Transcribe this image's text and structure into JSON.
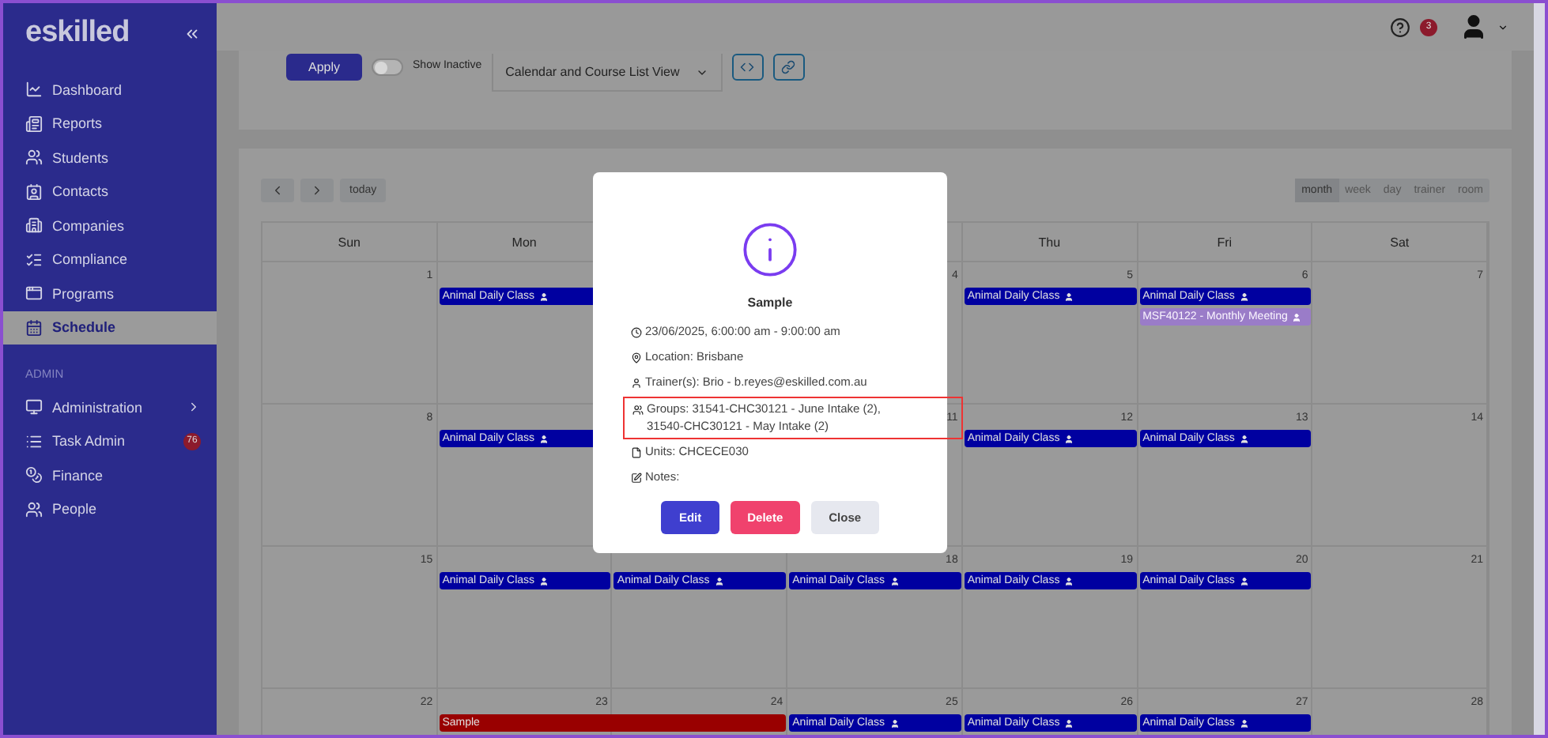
{
  "sidebar": {
    "logo": "eskilled",
    "items": [
      {
        "label": "Dashboard",
        "selected": false
      },
      {
        "label": "Reports",
        "selected": false
      },
      {
        "label": "Students",
        "selected": false
      },
      {
        "label": "Contacts",
        "selected": false
      },
      {
        "label": "Companies",
        "selected": false
      },
      {
        "label": "Compliance",
        "selected": false
      },
      {
        "label": "Programs",
        "selected": false
      },
      {
        "label": "Schedule",
        "selected": true
      }
    ],
    "section": "ADMIN",
    "admin_items": [
      {
        "label": "Administration",
        "selected": false,
        "submenu": true
      },
      {
        "label": "Task Admin",
        "selected": false,
        "submenu": false,
        "badge": "76"
      },
      {
        "label": "Finance",
        "selected": false,
        "submenu": false
      },
      {
        "label": "People",
        "selected": false,
        "submenu": false
      }
    ]
  },
  "header": {
    "help_badge": "3"
  },
  "filters": {
    "apply": "Apply",
    "show_inactive": {
      "label": "Show Inactive",
      "on": false
    },
    "view_select": "Calendar and Course List View"
  },
  "calendar": {
    "today": "today",
    "views": [
      {
        "label": "month",
        "selected": true
      },
      {
        "label": "week",
        "selected": false
      },
      {
        "label": "day",
        "selected": false
      },
      {
        "label": "trainer",
        "selected": false
      },
      {
        "label": "room",
        "selected": false
      }
    ],
    "weekdays_left": [
      "Sun",
      "Mon"
    ],
    "weekdays_right": [
      "Thu",
      "Fri",
      "Sat"
    ],
    "weeks": [
      {
        "days_left": [
          {
            "day": "1"
          },
          {
            "events": [
              {
                "title": "Animal Daily Class",
                "color": "#0000a0",
                "kind": "one-day",
                "has_trainer": true,
                "muted": false
              }
            ]
          }
        ],
        "days_right": [
          {
            "day": "4"
          },
          {
            "day": "5",
            "events": [
              {
                "title": "Animal Daily Class",
                "color": "#0000a0",
                "kind": "one-day",
                "has_trainer": true,
                "muted": false
              }
            ]
          },
          {
            "day": "6",
            "events": [
              {
                "title": "Animal Daily Class",
                "color": "#0000a0",
                "kind": "one-day",
                "has_trainer": true,
                "muted": false
              },
              {
                "title": "MSF40122 - Monthly Meeting",
                "color": "#9a7cc8",
                "kind": "one-day",
                "has_trainer": true,
                "muted": true
              }
            ]
          },
          {
            "day": "7"
          }
        ]
      },
      {
        "days_left": [
          {
            "day": "8"
          },
          {
            "events": [
              {
                "title": "Animal Daily Class",
                "color": "#0000a0",
                "kind": "one-day",
                "has_trainer": true,
                "muted": false
              }
            ]
          }
        ],
        "days_right": [
          {
            "day": "11"
          },
          {
            "day": "12",
            "events": [
              {
                "title": "Animal Daily Class",
                "color": "#0000a0",
                "kind": "one-day",
                "has_trainer": true,
                "muted": false
              }
            ]
          },
          {
            "day": "13",
            "events": [
              {
                "title": "Animal Daily Class",
                "color": "#0000a0",
                "kind": "one-day",
                "has_trainer": true,
                "muted": false
              }
            ]
          },
          {
            "day": "14"
          }
        ]
      },
      {
        "days": [
          {
            "day": "15"
          },
          {
            "events": [
              {
                "title": "Animal Daily Class",
                "color": "#0000a0",
                "kind": "one-day",
                "has_trainer": true,
                "muted": false
              }
            ]
          },
          {
            "events": [
              {
                "title": "Animal Daily Class",
                "color": "#0000a0",
                "kind": "one-day",
                "has_trainer": true,
                "muted": false
              }
            ]
          },
          {
            "day": "18",
            "events": [
              {
                "title": "Animal Daily Class",
                "color": "#0000a0",
                "kind": "one-day",
                "has_trainer": true,
                "muted": false
              }
            ]
          },
          {
            "day": "19",
            "events": [
              {
                "title": "Animal Daily Class",
                "color": "#0000a0",
                "kind": "one-day",
                "has_trainer": true,
                "muted": false
              }
            ]
          },
          {
            "day": "20",
            "events": [
              {
                "title": "Animal Daily Class",
                "color": "#0000a0",
                "kind": "one-day",
                "has_trainer": true,
                "muted": false
              }
            ]
          },
          {
            "day": "21"
          }
        ]
      },
      {
        "days": [
          {
            "day": "22"
          },
          {
            "day": "23",
            "events": [
              {
                "title": "Sample",
                "color": "#990000",
                "kind": "two-day",
                "has_trainer": false,
                "muted": false
              }
            ]
          },
          {
            "day": "24"
          },
          {
            "day": "25",
            "events": [
              {
                "title": "Animal Daily Class",
                "color": "#0000a0",
                "kind": "one-day",
                "has_trainer": true,
                "muted": false
              }
            ]
          },
          {
            "day": "26",
            "events": [
              {
                "title": "Animal Daily Class",
                "color": "#0000a0",
                "kind": "one-day",
                "has_trainer": true,
                "muted": false
              }
            ]
          },
          {
            "day": "27",
            "events": [
              {
                "title": "Animal Daily Class",
                "color": "#0000a0",
                "kind": "one-day",
                "has_trainer": true,
                "muted": false
              }
            ]
          },
          {
            "day": "28"
          }
        ]
      }
    ]
  },
  "modal": {
    "title": "Sample",
    "details": [
      {
        "kind": "time",
        "text": "23/06/2025, 6:00:00 am - 9:00:00 am",
        "highlighted": false
      },
      {
        "kind": "location",
        "text": "Location: Brisbane",
        "highlighted": false
      },
      {
        "kind": "trainer",
        "text": "Trainer(s): Brio - b.reyes@eskilled.com.au",
        "highlighted": false
      },
      {
        "kind": "groups",
        "text": "Groups:   31541-CHC30121 - June Intake (2),  31540-CHC30121 - May Intake (2)",
        "highlighted": true
      },
      {
        "kind": "units",
        "text": "Units: CHCECE030",
        "highlighted": false
      },
      {
        "kind": "notes",
        "text": "Notes:",
        "highlighted": false
      }
    ],
    "buttons": [
      {
        "label": "Edit",
        "kind": "primary"
      },
      {
        "label": "Delete",
        "kind": "danger"
      },
      {
        "label": "Close",
        "kind": "secondary"
      }
    ]
  }
}
